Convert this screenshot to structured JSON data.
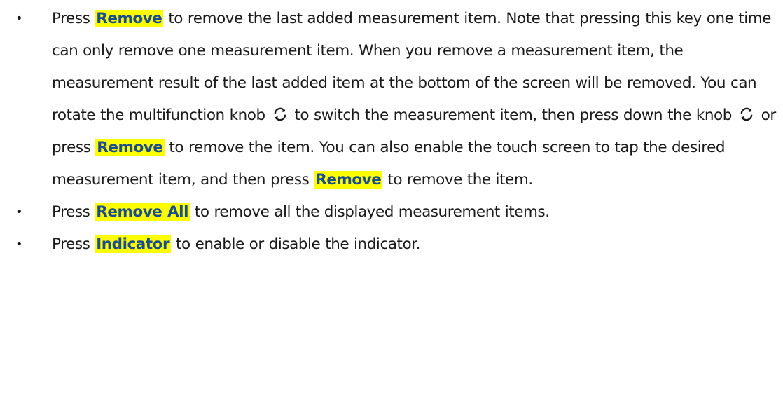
{
  "bullet_glyph": "•",
  "items": [
    {
      "parts": {
        "t0": "Press ",
        "k0": "Remove",
        "t1": " to remove the last added measurement item. Note that pressing this key one time can only remove one measurement item. When you remove a measurement item, the measurement result of the last added item at the bottom of the screen will be removed. You can rotate the multifunction knob ",
        "t2": " to switch the measurement item, then press down the knob ",
        "t3": " or press ",
        "k1": "Remove",
        "t4": " to remove the item. You can also enable the touch screen to tap the desired measurement item, and then press ",
        "k2": "Remove",
        "t5": " to remove the item."
      }
    },
    {
      "parts": {
        "t0": "Press ",
        "k0": "Remove All",
        "t1": " to remove all the displayed measurement items."
      }
    },
    {
      "parts": {
        "t0": "Press ",
        "k0": "Indicator",
        "t1": " to enable or disable the indicator."
      }
    }
  ],
  "icons": {
    "knob": "multifunction-knob-icon"
  },
  "colors": {
    "key_highlight": "#ffff00",
    "key_text": "#1a4d8f",
    "body_text": "#1a1a1a"
  }
}
